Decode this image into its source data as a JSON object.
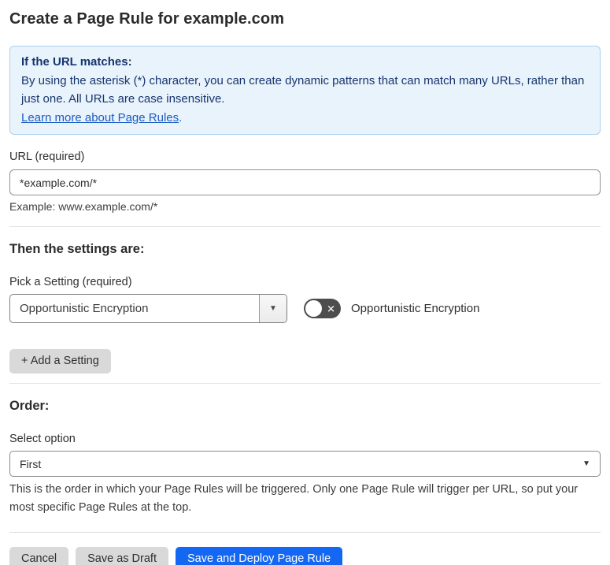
{
  "page": {
    "title": "Create a Page Rule for example.com"
  },
  "info_box": {
    "heading": "If the URL matches:",
    "body": "By using the asterisk (*) character, you can create dynamic patterns that can match many URLs, rather than just one. All URLs are case insensitive.",
    "link_label": "Learn more about Page Rules",
    "link_suffix": ".",
    "bg_color": "#e9f3fc",
    "border_color": "#abcfec",
    "text_color": "#16356d",
    "link_color": "#1a5bc5"
  },
  "url_field": {
    "label": "URL (required)",
    "value": "*example.com/*",
    "example": "Example: www.example.com/*"
  },
  "settings": {
    "heading": "Then the settings are:",
    "picker_label": "Pick a Setting (required)",
    "selected_setting": "Opportunistic Encryption",
    "dropdown_caret": "▼",
    "toggle": {
      "label": "Opportunistic Encryption",
      "state": "off",
      "glyph": "✕",
      "track_color": "#4d4d4d"
    },
    "add_button_label": "+ Add a Setting"
  },
  "order": {
    "heading": "Order:",
    "select_label": "Select option",
    "selected_option": "First",
    "select_caret": "▼",
    "description": "This is the order in which your Page Rules will be triggered. Only one Page Rule will trigger per URL, so put your most specific Page Rules at the top."
  },
  "actions": {
    "cancel_label": "Cancel",
    "save_draft_label": "Save as Draft",
    "deploy_label": "Save and Deploy Page Rule",
    "deploy_color": "#1467f2",
    "secondary_color": "#d9d9d9"
  }
}
